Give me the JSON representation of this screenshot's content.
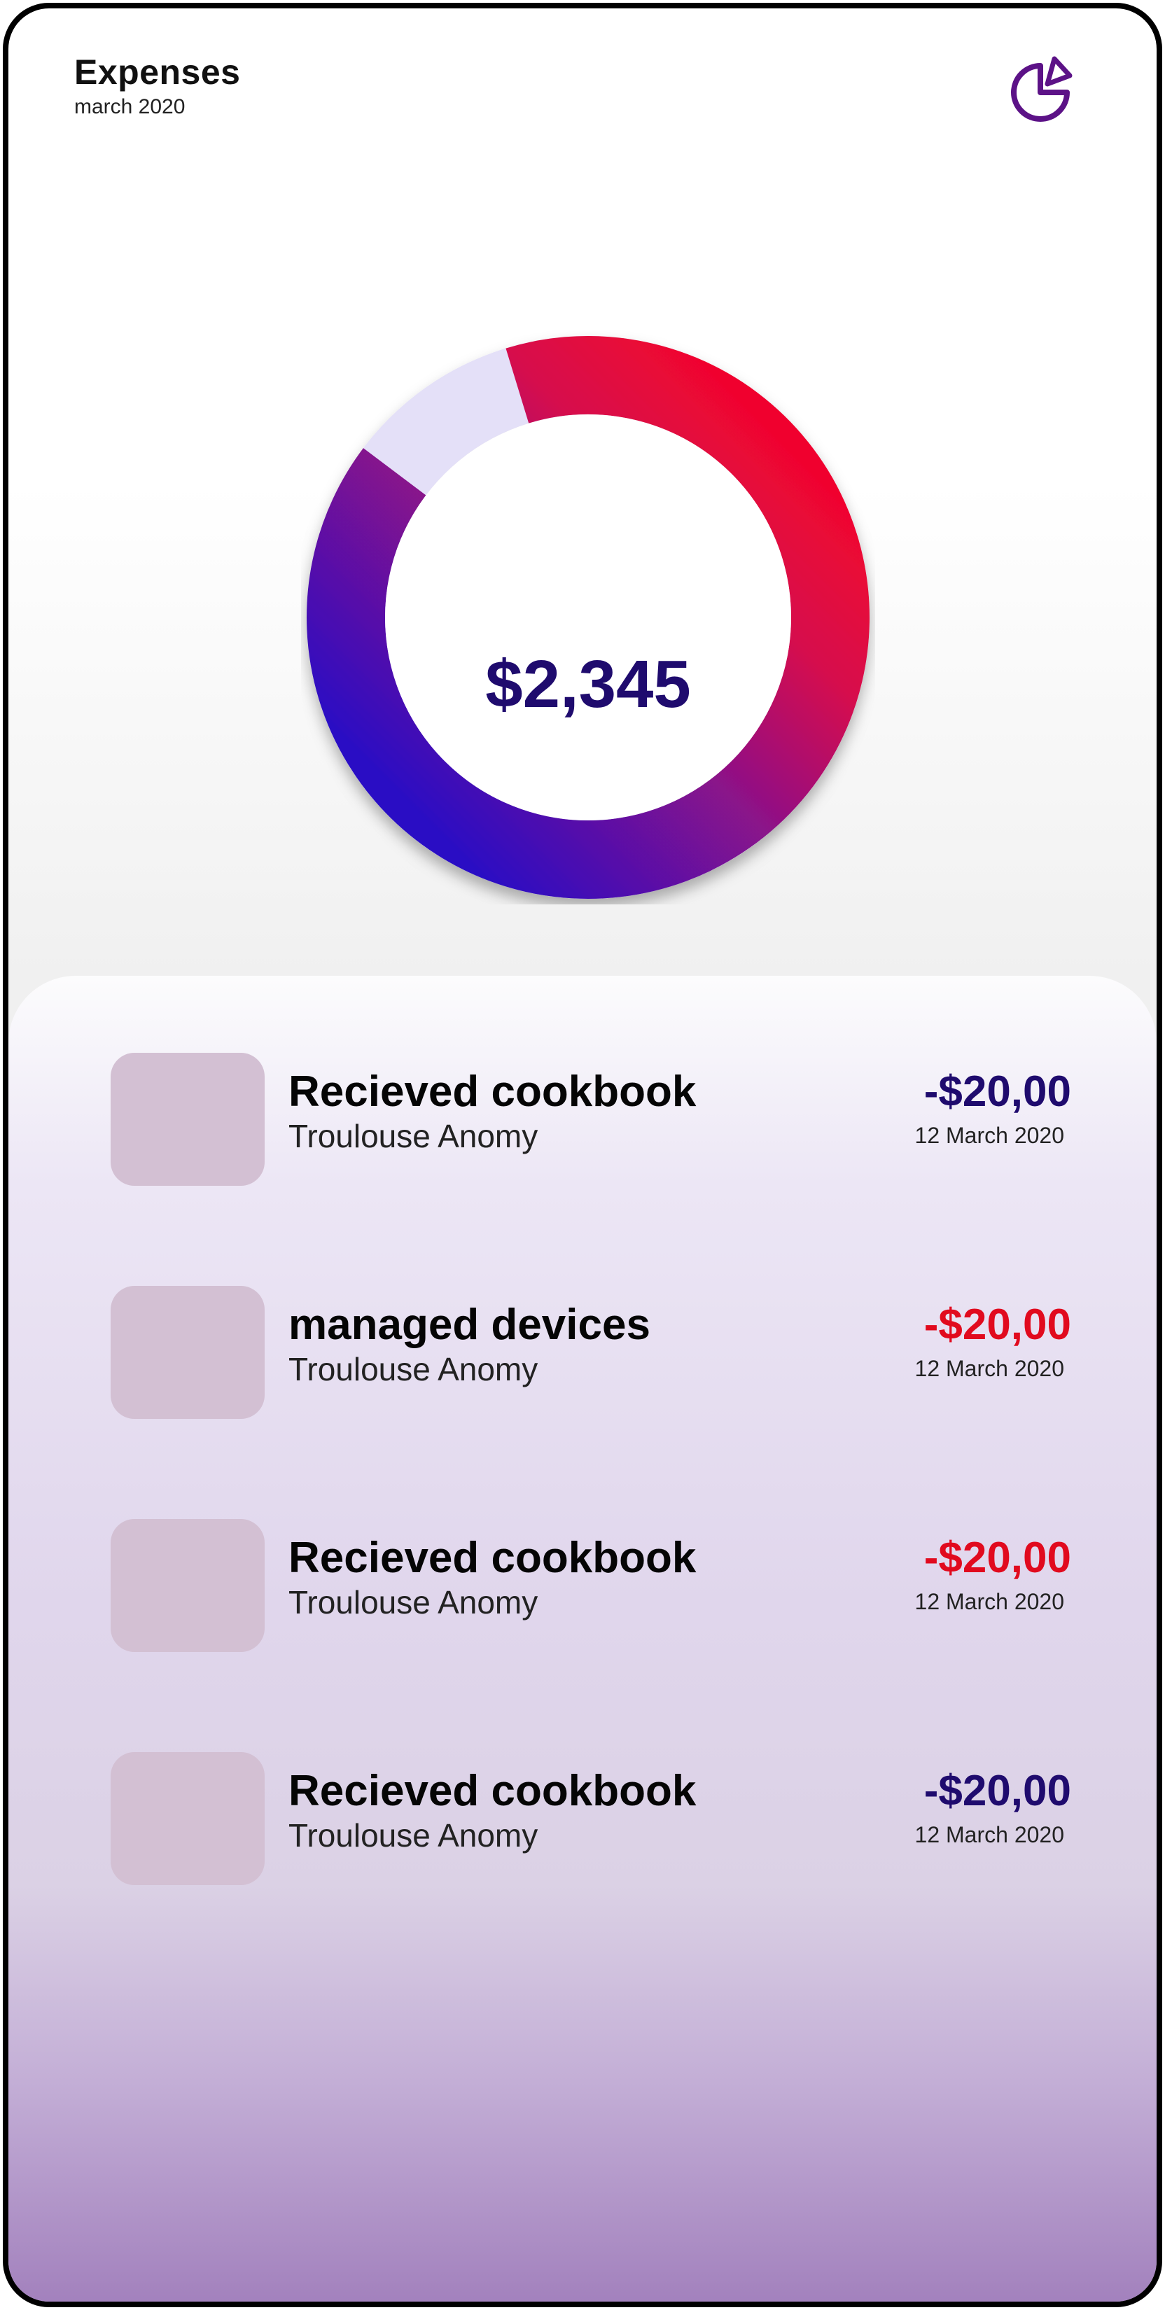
{
  "header": {
    "title": "Expenses",
    "subtitle": "march 2020",
    "chart_icon": "pie-chart-icon"
  },
  "summary": {
    "total": "$2,345"
  },
  "chart_data": {
    "type": "pie",
    "segments": [
      {
        "share": 0.9,
        "gradient": [
          "#2a10c4",
          "#e8083a"
        ]
      },
      {
        "share": 0.1,
        "color": "#e4e0f8"
      }
    ]
  },
  "colors": {
    "accent_purple": "#5c1287",
    "amount_default": "#1f0b6e",
    "amount_alert": "#e10a1e"
  },
  "transactions": [
    {
      "title": "Recieved cookbook",
      "subtitle": "Troulouse Anomy",
      "amount": "-$20,00",
      "date": "12 March 2020",
      "amount_color": "#1f0b6e"
    },
    {
      "title": "managed devices",
      "subtitle": "Troulouse Anomy",
      "amount": "-$20,00",
      "date": "12 March 2020",
      "amount_color": "#e10a1e"
    },
    {
      "title": "Recieved cookbook",
      "subtitle": "Troulouse Anomy",
      "amount": "-$20,00",
      "date": "12 March 2020",
      "amount_color": "#e10a1e"
    },
    {
      "title": "Recieved cookbook",
      "subtitle": "Troulouse Anomy",
      "amount": "-$20,00",
      "date": "12 March 2020",
      "amount_color": "#1f0b6e"
    }
  ]
}
